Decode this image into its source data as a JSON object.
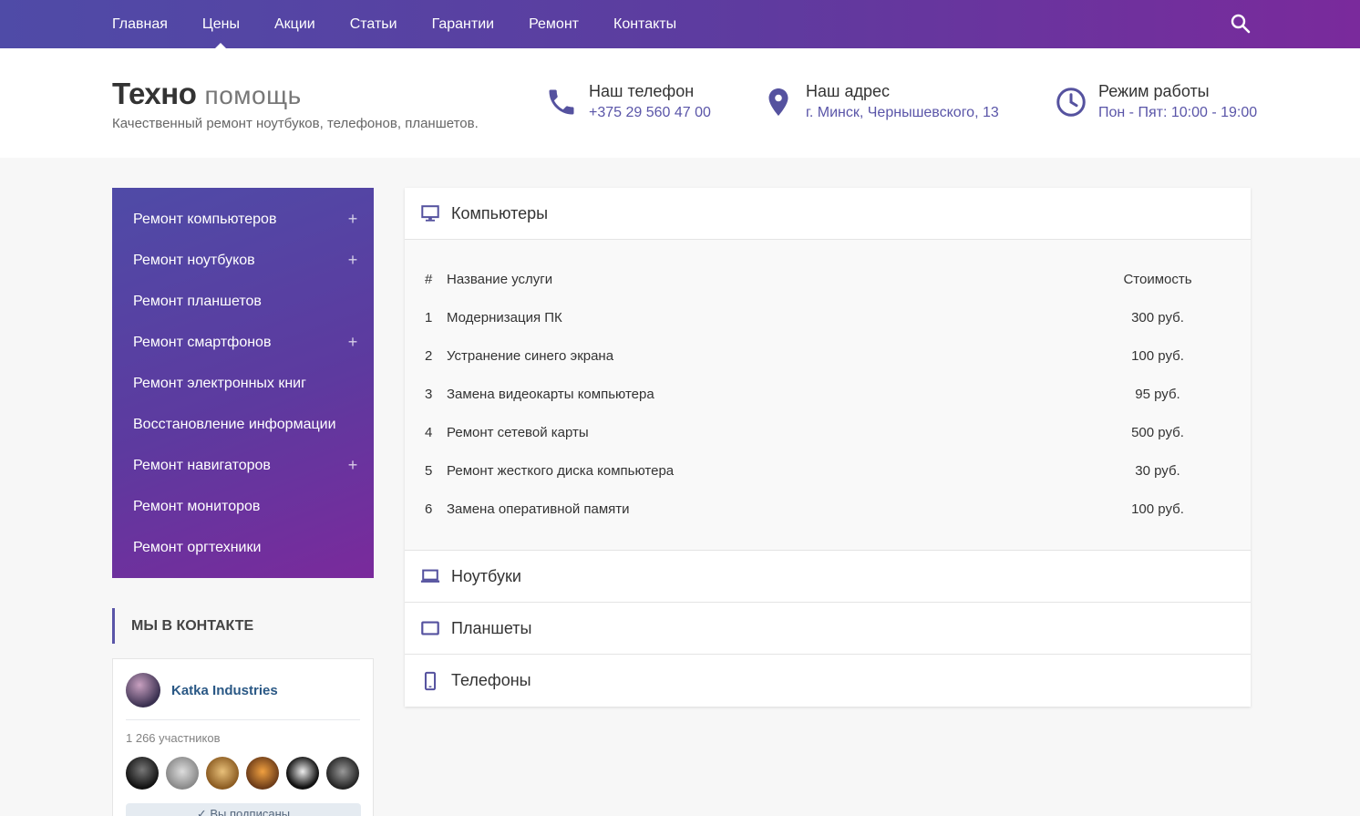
{
  "nav": {
    "items": [
      {
        "label": "Главная"
      },
      {
        "label": "Цены",
        "active": true
      },
      {
        "label": "Акции"
      },
      {
        "label": "Статьи"
      },
      {
        "label": "Гарантии"
      },
      {
        "label": "Ремонт"
      },
      {
        "label": "Контакты"
      }
    ],
    "search_icon": "search-icon"
  },
  "brand": {
    "name_bold": "Техно",
    "name_light": "помощь",
    "tagline": "Качественный ремонт ноутбуков, телефонов, планшетов."
  },
  "contacts": {
    "phone": {
      "title": "Наш телефон",
      "value": "+375 29 560 47 00",
      "icon": "phone-icon"
    },
    "address": {
      "title": "Наш адрес",
      "value": "г. Минск, Чернышевского, 13",
      "icon": "map-pin-icon"
    },
    "hours": {
      "title": "Режим работы",
      "value": "Пон - Пят: 10:00 - 19:00",
      "icon": "clock-icon"
    }
  },
  "sidebar": {
    "items": [
      {
        "label": "Ремонт компьютеров",
        "plus": "+"
      },
      {
        "label": "Ремонт ноутбуков",
        "plus": "+"
      },
      {
        "label": "Ремонт планшетов",
        "plus": ""
      },
      {
        "label": "Ремонт смартфонов",
        "plus": "+"
      },
      {
        "label": "Ремонт электронных книг",
        "plus": ""
      },
      {
        "label": "Восстановление информации",
        "plus": ""
      },
      {
        "label": "Ремонт навигаторов",
        "plus": "+"
      },
      {
        "label": "Ремонт мониторов",
        "plus": ""
      },
      {
        "label": "Ремонт оргтехники",
        "plus": ""
      }
    ]
  },
  "vk": {
    "title": "МЫ В КОНТАКТЕ",
    "group_name": "Katka Industries",
    "members": "1 266 участников",
    "button": "✓ Вы подписаны"
  },
  "prices": {
    "sections": [
      {
        "label": "Компьютеры",
        "icon": "monitor-icon"
      },
      {
        "label": "Ноутбуки",
        "icon": "laptop-icon"
      },
      {
        "label": "Планшеты",
        "icon": "tablet-icon"
      },
      {
        "label": "Телефоны",
        "icon": "phone-device-icon"
      }
    ],
    "table": {
      "headers": {
        "num": "#",
        "name": "Название услуги",
        "price": "Стоимость"
      },
      "rows": [
        {
          "num": "1",
          "name": "Модернизация ПК",
          "price": "300 руб."
        },
        {
          "num": "2",
          "name": "Устранение синего экрана",
          "price": "100 руб."
        },
        {
          "num": "3",
          "name": "Замена видеокарты компьютера",
          "price": "95 руб."
        },
        {
          "num": "4",
          "name": "Ремонт сетевой карты",
          "price": "500 руб."
        },
        {
          "num": "5",
          "name": "Ремонт жесткого диска компьютера",
          "price": "30 руб."
        },
        {
          "num": "6",
          "name": "Замена оперативной памяти",
          "price": "100 руб."
        }
      ]
    }
  },
  "colors": {
    "accent": "#5a55a8",
    "gradient_start": "#4f4ba7",
    "gradient_end": "#7a2a9c",
    "vk_link": "#2a5885"
  }
}
